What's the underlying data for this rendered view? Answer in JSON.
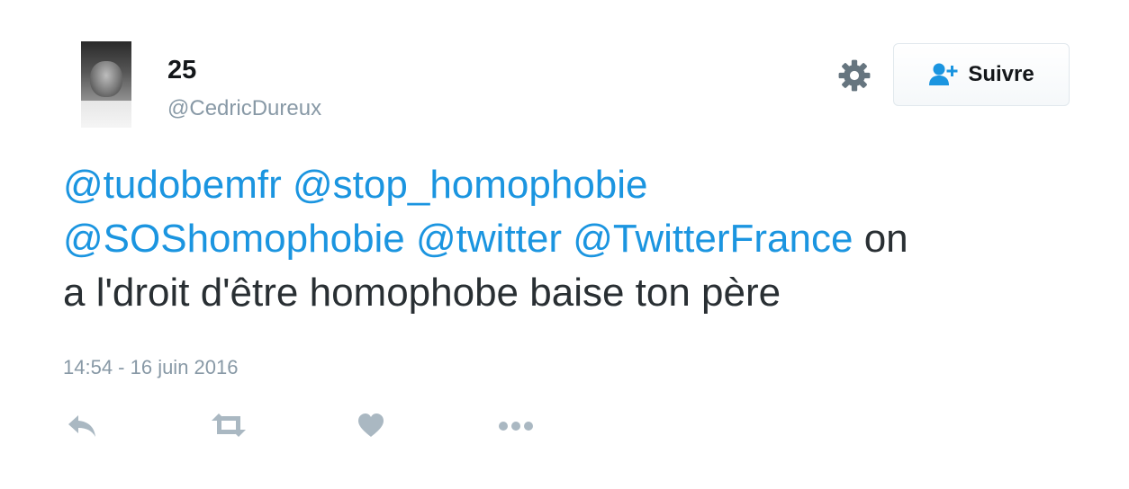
{
  "user": {
    "name": "25",
    "handle": "@CedricDureux"
  },
  "follow_button": {
    "label": "Suivre"
  },
  "tweet": {
    "mentions": [
      "@tudobemfr",
      "@stop_homophobie",
      "@SOShomophobie",
      "@twitter",
      "@TwitterFrance"
    ],
    "text_after_mentions_line2": "on",
    "text_line3": "a l'droit d'être homophobe baise ton père",
    "timestamp": "14:54 - 16 juin 2016"
  },
  "icons": {
    "settings": "gear-icon",
    "follow": "person-plus-icon",
    "reply": "reply-icon",
    "retweet": "retweet-icon",
    "like": "heart-icon",
    "more": "more-icon"
  },
  "colors": {
    "link": "#1b95e0",
    "text": "#292f33",
    "muted": "#8899a6",
    "action_icon": "#aab8c2",
    "gear": "#66757f"
  }
}
